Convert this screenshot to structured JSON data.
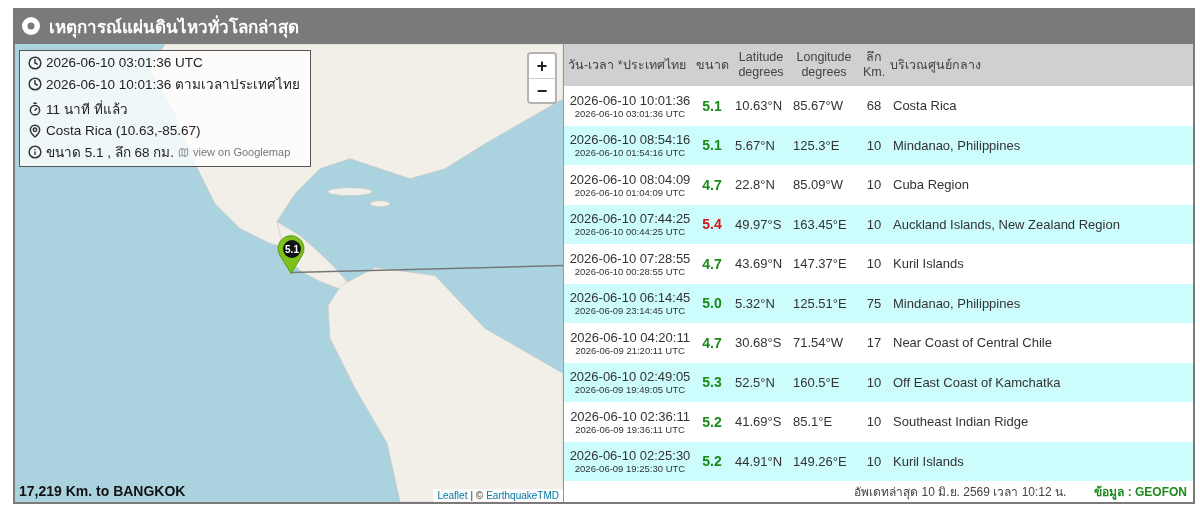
{
  "header": {
    "title": "เหตุการณ์แผ่นดินไหวทั่วโลกล่าสุด"
  },
  "map": {
    "info": {
      "utc": "2026-06-10 03:01:36 UTC",
      "thai_time": "2026-06-10 10:01:36 ตามเวลาประเทศไทย",
      "ago": "11 นาที ที่แล้ว",
      "location": "Costa Rica (10.63,-85.67)",
      "detail": "ขนาด 5.1 , ลึก 68 กม.",
      "map_link": "view on Googlemap"
    },
    "zoom_in": "+",
    "zoom_out": "−",
    "marker": {
      "label": "5.1"
    },
    "distance": "17,219 Km. to BANGKOK",
    "attribution": {
      "leaflet": "Leaflet",
      "separator": "| ©",
      "source": "EarthquakeTMD"
    }
  },
  "table": {
    "columns": [
      {
        "lines": [
          "วัน-เวลา *ประเทศไทย"
        ]
      },
      {
        "lines": [
          "ขนาด"
        ]
      },
      {
        "lines": [
          "Latitude",
          "degrees"
        ]
      },
      {
        "lines": [
          "Longitude",
          "degrees"
        ]
      },
      {
        "lines": [
          "ลึก",
          "Km."
        ]
      },
      {
        "lines": [
          "บริเวณศูนย์กลาง"
        ]
      }
    ],
    "rows": [
      {
        "time": "2026-06-10 10:01:36",
        "utc": "2026-06-10 03:01:36 UTC",
        "magnitude": "5.1",
        "color": "#1a8a1a",
        "lat": "10.63°N",
        "lon": "85.67°W",
        "depth": "68",
        "region": "Costa Rica"
      },
      {
        "time": "2026-06-10 08:54:16",
        "utc": "2026-06-10 01:54:16 UTC",
        "magnitude": "5.1",
        "color": "#1a8a1a",
        "lat": "5.67°N",
        "lon": "125.3°E",
        "depth": "10",
        "region": "Mindanao, Philippines"
      },
      {
        "time": "2026-06-10 08:04:09",
        "utc": "2026-06-10 01:04:09 UTC",
        "magnitude": "4.7",
        "color": "#1a8a1a",
        "lat": "22.8°N",
        "lon": "85.09°W",
        "depth": "10",
        "region": "Cuba Region"
      },
      {
        "time": "2026-06-10 07:44:25",
        "utc": "2026-06-10 00:44:25 UTC",
        "magnitude": "5.4",
        "color": "#d01818",
        "lat": "49.97°S",
        "lon": "163.45°E",
        "depth": "10",
        "region": "Auckland Islands, New Zealand Region"
      },
      {
        "time": "2026-06-10 07:28:55",
        "utc": "2026-06-10 00:28:55 UTC",
        "magnitude": "4.7",
        "color": "#1a8a1a",
        "lat": "43.69°N",
        "lon": "147.37°E",
        "depth": "10",
        "region": "Kuril Islands"
      },
      {
        "time": "2026-06-10 06:14:45",
        "utc": "2026-06-09 23:14:45 UTC",
        "magnitude": "5.0",
        "color": "#1a8a1a",
        "lat": "5.32°N",
        "lon": "125.51°E",
        "depth": "75",
        "region": "Mindanao, Philippines"
      },
      {
        "time": "2026-06-10 04:20:11",
        "utc": "2026-06-09 21:20:11 UTC",
        "magnitude": "4.7",
        "color": "#1a8a1a",
        "lat": "30.68°S",
        "lon": "71.54°W",
        "depth": "17",
        "region": "Near Coast of Central Chile"
      },
      {
        "time": "2026-06-10 02:49:05",
        "utc": "2026-06-09 19:49:05 UTC",
        "magnitude": "5.3",
        "color": "#1a8a1a",
        "lat": "52.5°N",
        "lon": "160.5°E",
        "depth": "10",
        "region": "Off East Coast of Kamchatka"
      },
      {
        "time": "2026-06-10 02:36:11",
        "utc": "2026-06-09 19:36:11 UTC",
        "magnitude": "5.2",
        "color": "#1a8a1a",
        "lat": "41.69°S",
        "lon": "85.1°E",
        "depth": "10",
        "region": "Southeast Indian Ridge"
      },
      {
        "time": "2026-06-10 02:25:30",
        "utc": "2026-06-09 19:25:30 UTC",
        "magnitude": "5.2",
        "color": "#1a8a1a",
        "lat": "44.91°N",
        "lon": "149.26°E",
        "depth": "10",
        "region": "Kuril Islands"
      }
    ]
  },
  "footer": {
    "updated": "อัพเดทล่าสุด 10 มิ.ย. 2569 เวลา 10:12 น.",
    "source": "ข้อมูล : GEOFON"
  }
}
